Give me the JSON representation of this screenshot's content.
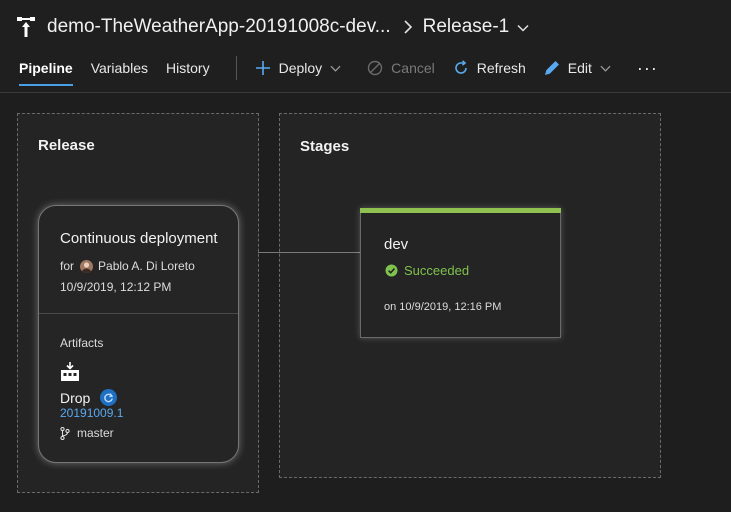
{
  "header": {
    "pipeline_title": "demo-TheWeatherApp-20191008c-dev...",
    "release_name": "Release-1"
  },
  "tabs": [
    {
      "label": "Pipeline",
      "active": true
    },
    {
      "label": "Variables",
      "active": false
    },
    {
      "label": "History",
      "active": false
    }
  ],
  "toolbar": {
    "deploy_label": "Deploy",
    "cancel_label": "Cancel",
    "refresh_label": "Refresh",
    "edit_label": "Edit",
    "more_label": "···"
  },
  "release_panel": {
    "title": "Release",
    "card": {
      "title": "Continuous deployment",
      "for_label": "for",
      "user": "Pablo A. Di Loreto",
      "date": "10/9/2019, 12:12 PM",
      "artifacts_label": "Artifacts",
      "artifact_name": "Drop",
      "build": "20191009.1",
      "branch": "master"
    }
  },
  "stages_panel": {
    "title": "Stages",
    "stage": {
      "name": "dev",
      "status": "Succeeded",
      "date": "on 10/9/2019, 12:16 PM"
    }
  },
  "colors": {
    "accent": "#4aa0e6",
    "success": "#8ec14f",
    "link": "#5aa9f0"
  }
}
